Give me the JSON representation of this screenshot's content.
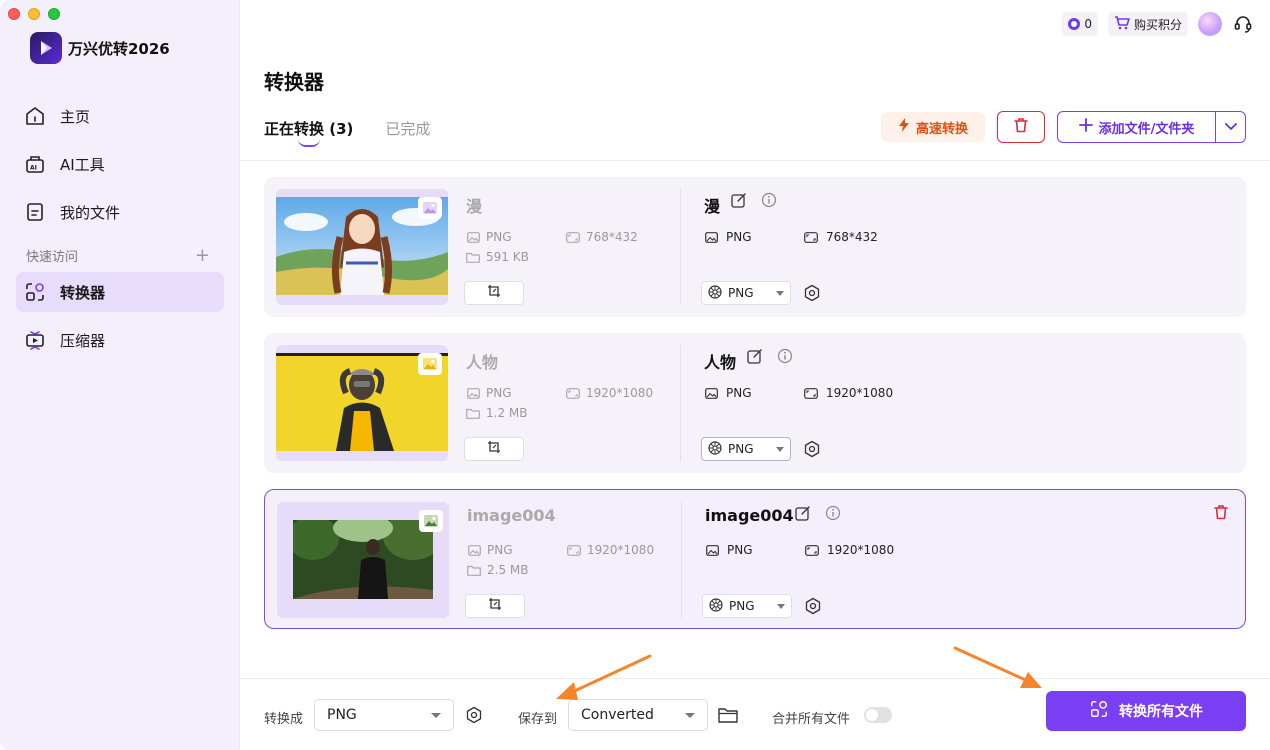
{
  "app": {
    "name": "万兴优转2026",
    "points_count": "0",
    "buy_points_label": "购买积分"
  },
  "sidebar": {
    "items": [
      {
        "label": "主页",
        "icon": "home-icon"
      },
      {
        "label": "AI工具",
        "icon": "ai-tools-icon"
      },
      {
        "label": "我的文件",
        "icon": "my-files-icon"
      }
    ],
    "quick_access_label": "快速访问",
    "quick_add": "+",
    "quick_items": [
      {
        "label": "转换器",
        "icon": "converter-icon",
        "active": true
      },
      {
        "label": "压缩器",
        "icon": "compressor-icon",
        "active": false
      }
    ]
  },
  "main": {
    "title": "转换器",
    "tabs": [
      {
        "label": "正在转换 (3)",
        "active": true
      },
      {
        "label": "已完成",
        "active": false
      }
    ],
    "fast_convert_label": "高速转换",
    "add_files_label": "添加文件/文件夹"
  },
  "files": [
    {
      "src_name": "漫",
      "src_format": "PNG",
      "src_resolution": "768*432",
      "src_size": "591 KB",
      "dst_name": "漫",
      "dst_format": "PNG",
      "dst_resolution": "768*432",
      "target_format": "PNG",
      "selected": false
    },
    {
      "src_name": "人物",
      "src_format": "PNG",
      "src_resolution": "1920*1080",
      "src_size": "1.2 MB",
      "dst_name": "人物",
      "dst_format": "PNG",
      "dst_resolution": "1920*1080",
      "target_format": "PNG",
      "selected": false
    },
    {
      "src_name": "image004",
      "src_format": "PNG",
      "src_resolution": "1920*1080",
      "src_size": "2.5 MB",
      "dst_name": "image004",
      "dst_format": "PNG",
      "dst_resolution": "1920*1080",
      "target_format": "PNG",
      "selected": true
    }
  ],
  "footer": {
    "convert_to_label": "转换成",
    "convert_to_value": "PNG",
    "save_to_label": "保存到",
    "save_to_value": "Converted",
    "merge_label": "合并所有文件",
    "merge_enabled": false,
    "convert_all_label": "转换所有文件"
  },
  "colors": {
    "accent": "#7a3ff3",
    "sidebar_bg": "#f3effb",
    "danger": "#e02a3a",
    "fast": "#e14f16",
    "annotation_arrow": "#f5852a"
  }
}
